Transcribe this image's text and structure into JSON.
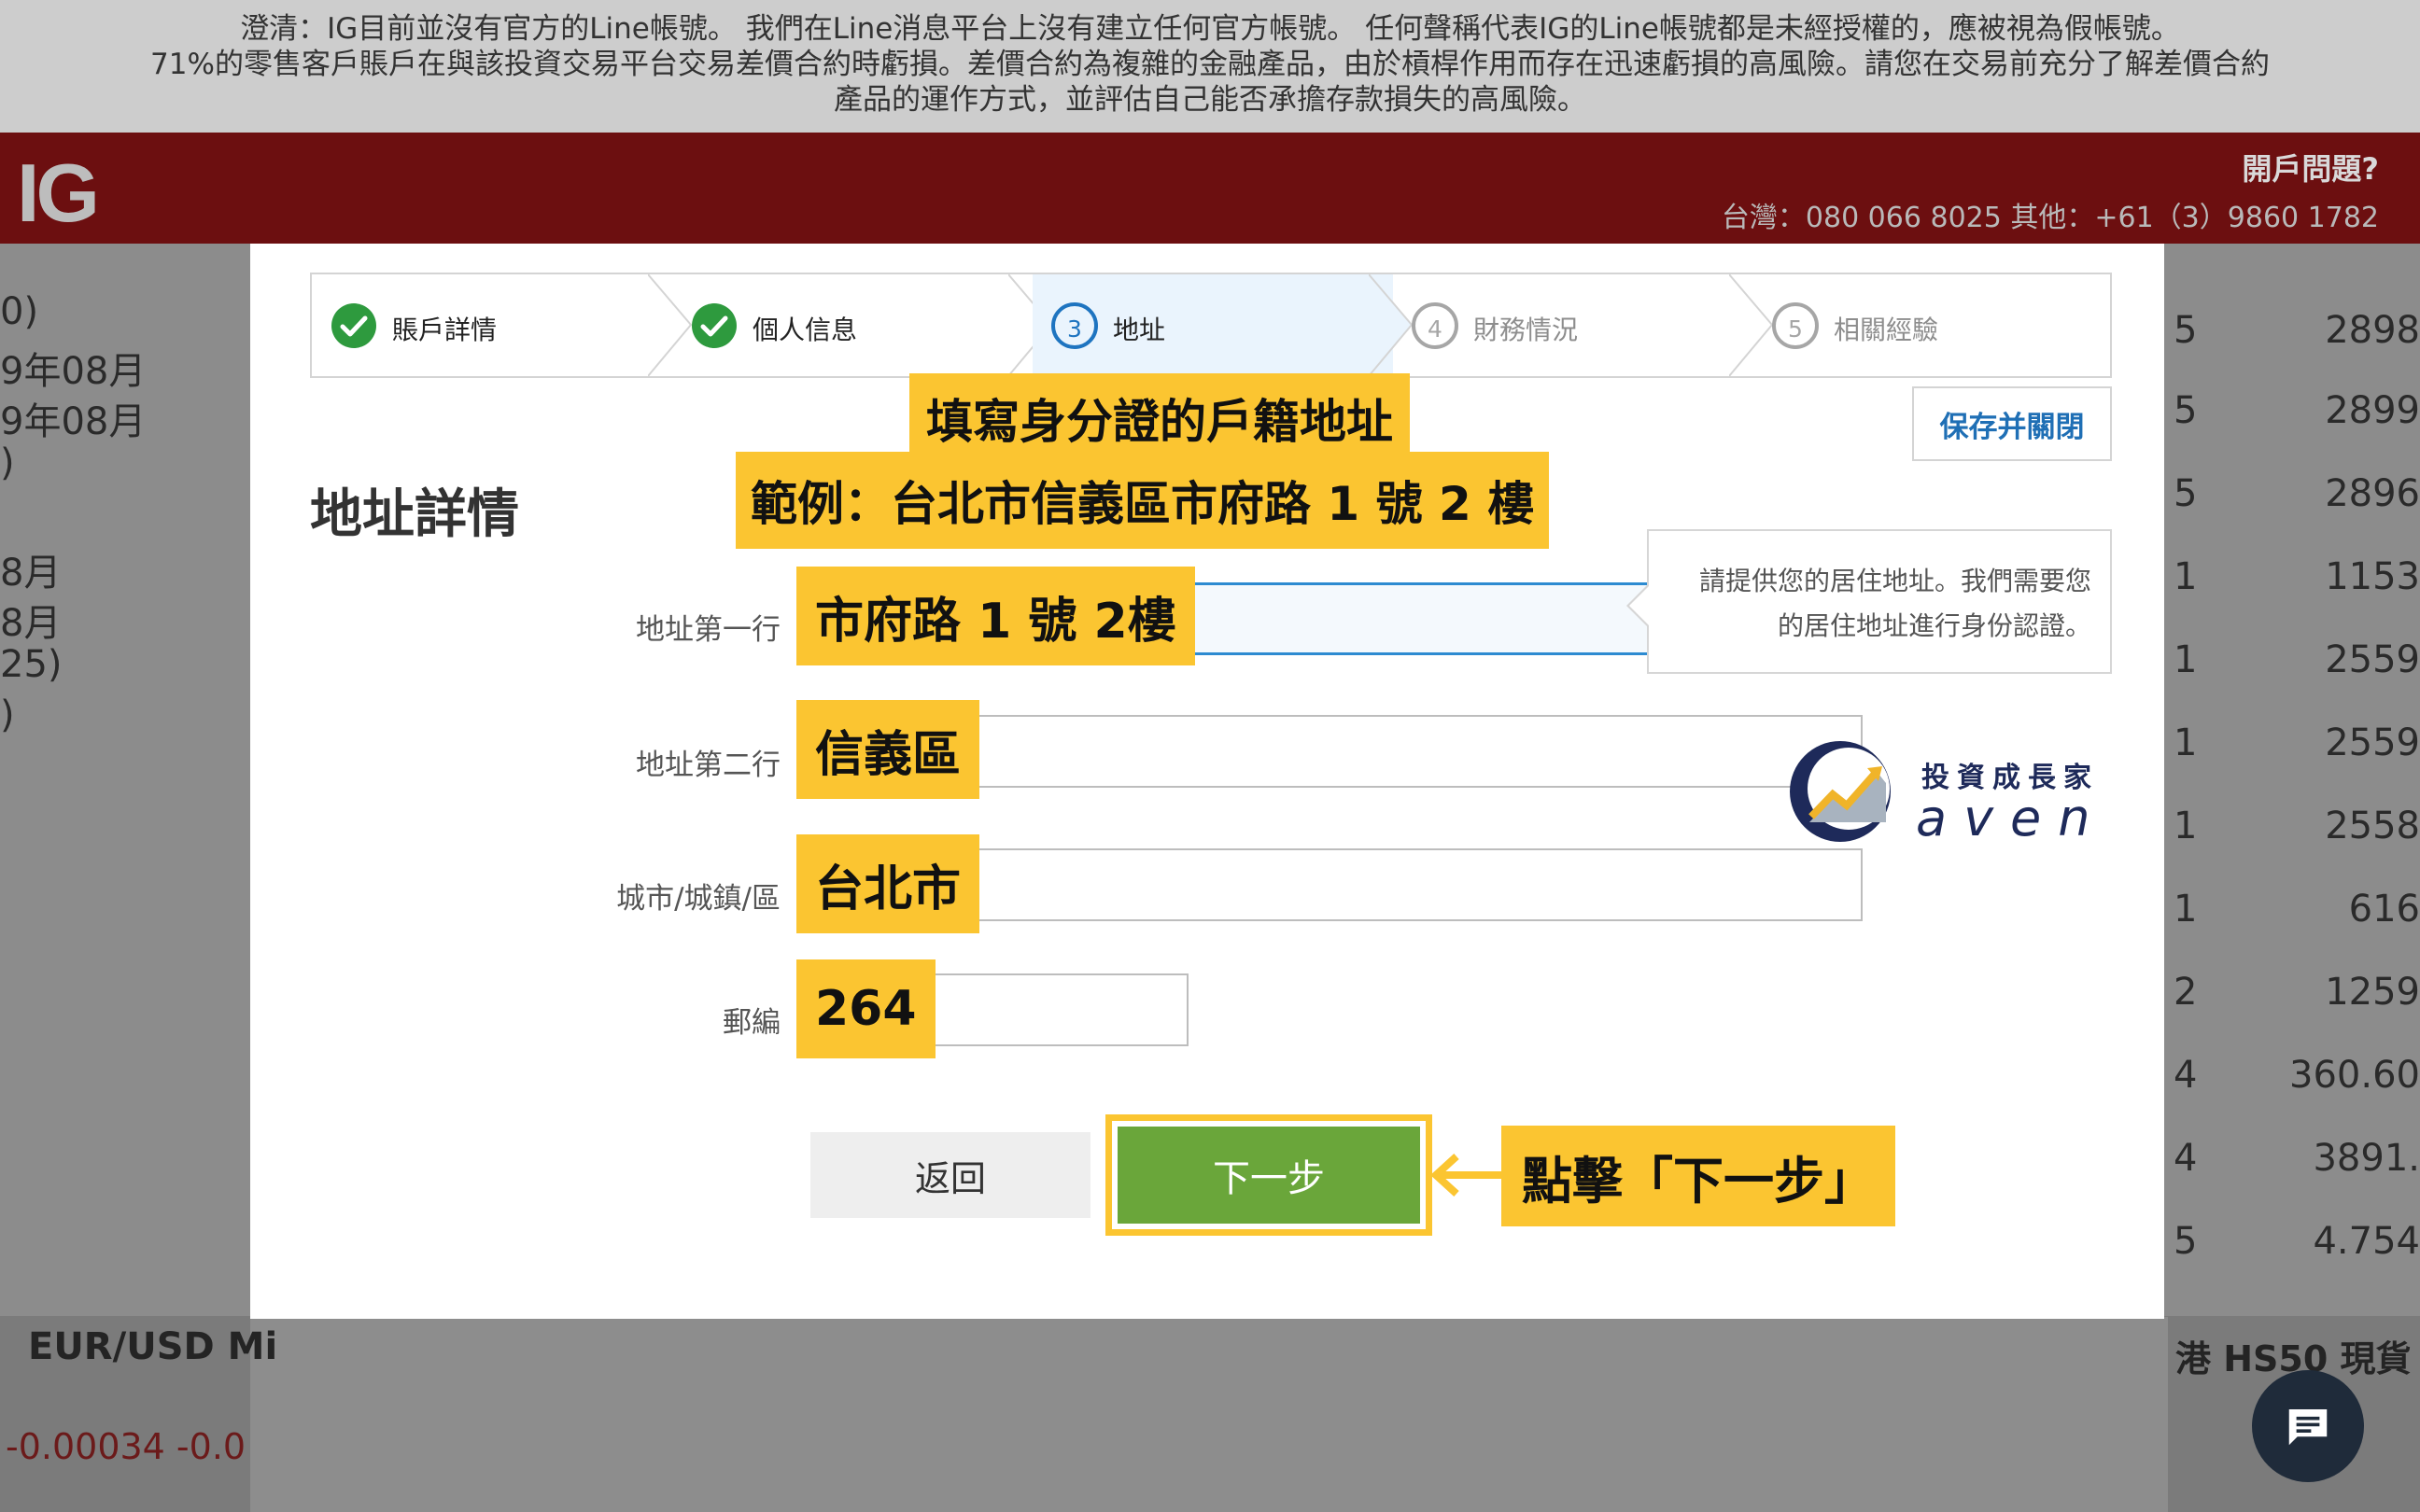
{
  "disclaimer": {
    "line1": "澄清：IG目前並沒有官方的Line帳號。 我們在Line消息平台上沒有建立任何官方帳號。 任何聲稱代表IG的Line帳號都是未經授權的，應被視為假帳號。",
    "line2": "71%的零售客戶賬戶在與該投資交易平台交易差價合約時虧損。差價合約為複雜的金融產品，由於槓桿作用而存在迅速虧損的高風險。請您在交易前充分了解差價合約",
    "line3": "產品的運作方式，並評估自己能否承擔存款損失的高風險。"
  },
  "header": {
    "logo": "IG",
    "open_question": "開戶問題?",
    "phones": "台灣：080 066 8025 其他：+61（3）9860 1782"
  },
  "background": {
    "left_rows": [
      "0)",
      "9年08月",
      "9年08月",
      ")",
      "",
      "8月",
      "8月",
      "25)",
      ")"
    ],
    "right_rows": [
      {
        "count": "5",
        "value": "2898"
      },
      {
        "count": "5",
        "value": "2899"
      },
      {
        "count": "5",
        "value": "2896"
      },
      {
        "count": "1",
        "value": "1153"
      },
      {
        "count": "1",
        "value": "2559"
      },
      {
        "count": "1",
        "value": "2559"
      },
      {
        "count": "1",
        "value": "2558"
      },
      {
        "count": "1",
        "value": "616"
      },
      {
        "count": "2",
        "value": "1259"
      },
      {
        "count": "4",
        "value": "360.60"
      },
      {
        "count": "4",
        "value": "3891."
      },
      {
        "count": "5",
        "value": "4.754"
      }
    ],
    "eurusd": "EUR/USD Mi",
    "eurusd_change": "-0.00034  -0.0",
    "hk50": "港 HS50 現貨"
  },
  "stepper": {
    "steps": [
      {
        "number": "1",
        "label": "賬戶詳情",
        "state": "done"
      },
      {
        "number": "2",
        "label": "個人信息",
        "state": "done"
      },
      {
        "number": "3",
        "label": "地址",
        "state": "active"
      },
      {
        "number": "4",
        "label": "財務情況",
        "state": "todo"
      },
      {
        "number": "5",
        "label": "相關經驗",
        "state": "todo"
      }
    ]
  },
  "modal": {
    "save_close": "保存并關閉",
    "section_title": "地址詳情",
    "help_line1": "請提供您的居住地址。我們需要您",
    "help_line2": "的居住地址進行身份認證。",
    "back": "返回",
    "next": "下一步"
  },
  "form": {
    "address1_label": "地址第一行",
    "address2_label": "地址第二行",
    "city_label": "城市/城鎮/區",
    "postcode_label": "郵編"
  },
  "annotations": {
    "title_line1": "填寫身分證的戶籍地址",
    "title_line2": "範例：台北市信義區市府路 1 號 2 樓",
    "address1": "市府路 1 號 2樓",
    "address2": "信義區",
    "city": "台北市",
    "postcode": "264",
    "click_next": "點擊「下一步」"
  },
  "watermark": {
    "cn": "投資成長家",
    "en": "aven"
  },
  "colors": {
    "header_red": "#6c0f10",
    "accent_blue": "#1e74c0",
    "next_green": "#6aa63a",
    "callout_yellow": "#fbc531",
    "done_green": "#2e9a3e"
  }
}
